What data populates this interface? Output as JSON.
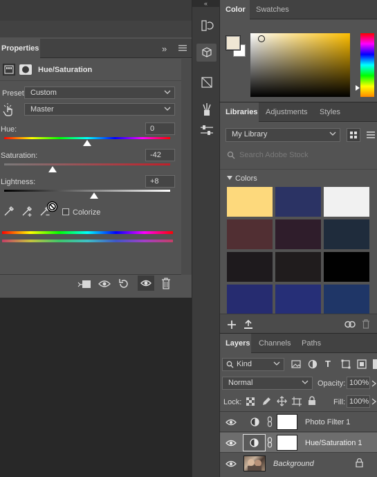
{
  "properties": {
    "tab_label": "Properties",
    "menu_arrows": "»",
    "adjustment_title": "Hue/Saturation",
    "preset_label": "Preset:",
    "preset_value": "Custom",
    "range_value": "Master",
    "hue_label": "Hue:",
    "hue_value": "0",
    "saturation_label": "Saturation:",
    "saturation_value": "-42",
    "lightness_label": "Lightness:",
    "lightness_value": "+8",
    "colorize_label": "Colorize",
    "colorize_checked": false
  },
  "color_panel": {
    "tabs": [
      "Color",
      "Swatches"
    ],
    "foreground": "#efe6d3",
    "background": "#ffffff",
    "picker_hue": "#ffbf00"
  },
  "libraries_panel": {
    "tabs": [
      "Libraries",
      "Adjustments",
      "Styles"
    ],
    "library_name": "My Library",
    "search_placeholder": "Search Adobe Stock",
    "section_label": "Colors",
    "colors": [
      "#fdd97c",
      "#2b3364",
      "#f1f1f1",
      "#512f33",
      "#2f1d2b",
      "#1f2c3c",
      "#1e1a1d",
      "#201c1d",
      "#010101",
      "#262c70",
      "#262f77",
      "#1f3667"
    ]
  },
  "layers_panel": {
    "tabs": [
      "Layers",
      "Channels",
      "Paths"
    ],
    "filter_kind": "Kind",
    "blend_mode": "Normal",
    "opacity_label": "Opacity:",
    "opacity_value": "100%",
    "lock_label": "Lock:",
    "fill_label": "Fill:",
    "fill_value": "100%",
    "layers": [
      {
        "name": "Photo Filter 1",
        "selected": false
      },
      {
        "name": "Hue/Saturation 1",
        "selected": true
      },
      {
        "name": "Background",
        "selected": false
      }
    ]
  }
}
